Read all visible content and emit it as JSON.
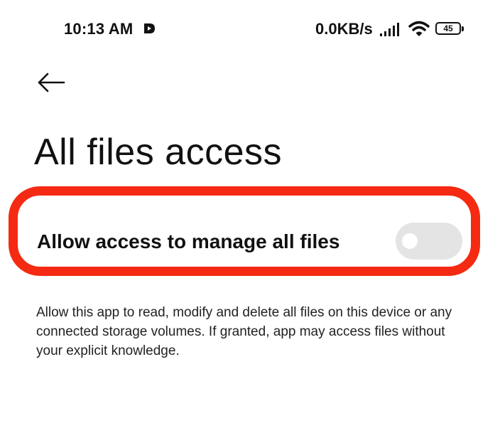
{
  "status_bar": {
    "time": "10:13 AM",
    "network_speed": "0.0KB/s",
    "battery_level": "45",
    "icons": {
      "app": "notification-app-icon",
      "signal": "cellular-signal-icon",
      "wifi": "wifi-icon",
      "battery": "battery-icon"
    }
  },
  "navigation": {
    "back_icon": "arrow-left-icon"
  },
  "page": {
    "title": "All files access"
  },
  "setting": {
    "label": "Allow access to manage all files",
    "toggle_state": "off"
  },
  "description": "Allow this app to read, modify and delete all files on this device or any connected storage volumes. If granted, app may access files without your explicit knowledge.",
  "colors": {
    "highlight": "#f52a12",
    "toggle_off_track": "#e4e4e4",
    "text": "#111111",
    "background": "#ffffff"
  }
}
